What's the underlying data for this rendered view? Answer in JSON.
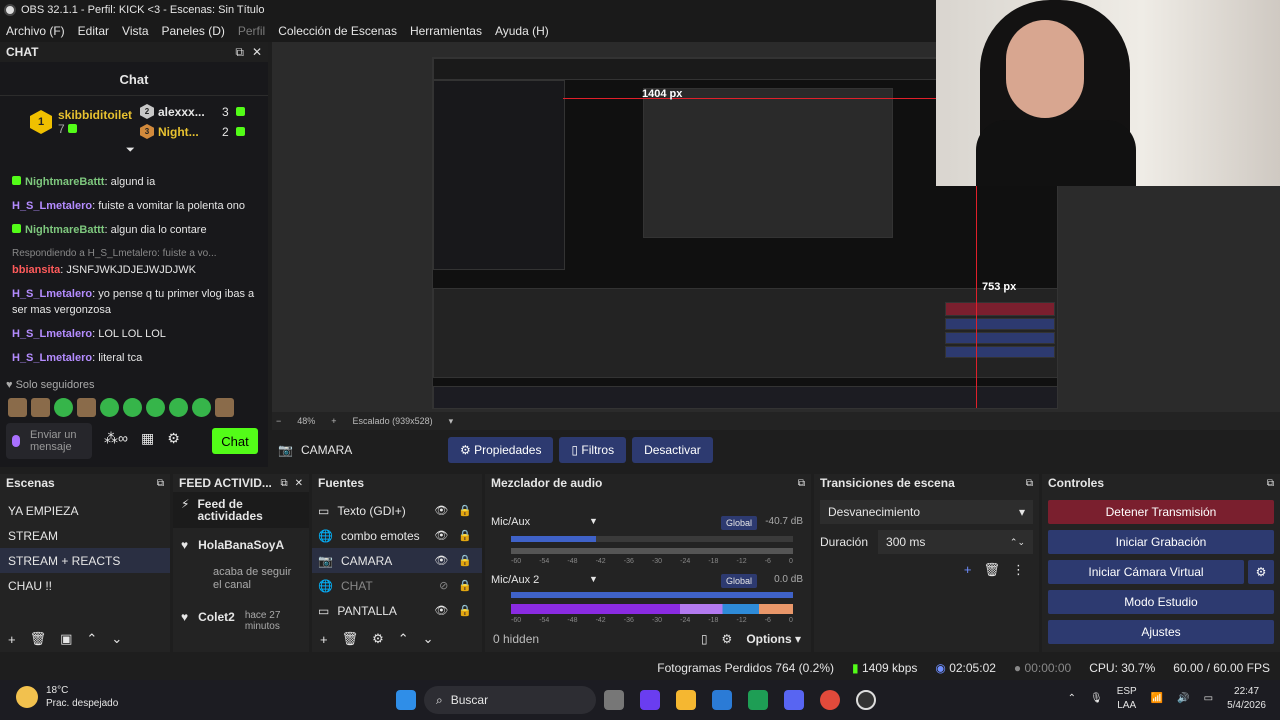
{
  "window": {
    "title": "OBS 32.1.1 - Perfil: KICK <3 - Escenas: Sin Título"
  },
  "menu": [
    "Archivo (F)",
    "Editar",
    "Vista",
    "Paneles (D)",
    "Perfil",
    "Colección de Escenas",
    "Herramientas",
    "Ayuda (H)"
  ],
  "chat": {
    "dock_title": "CHAT",
    "title": "Chat",
    "leader": {
      "rank": "1",
      "name": "skibbiditoilet",
      "count": "7"
    },
    "ranks": [
      {
        "rank": "2",
        "name": "alexxx...",
        "count": "3"
      },
      {
        "rank": "3",
        "name": "Night...",
        "count": "2"
      }
    ],
    "messages": [
      {
        "user": "NightmareBattt",
        "text": "algund ia"
      },
      {
        "user": "H_S_Lmetalero",
        "text": "fuiste a vomitar la polenta ono"
      },
      {
        "user": "NightmareBattt",
        "text": "algun dia lo contare"
      },
      {
        "reply": "Respondiendo a H_S_Lmetalero: fuiste a vo...",
        "user": "bbiansita",
        "text": "JSNFJWKJDJEJWJDJWK"
      },
      {
        "user": "H_S_Lmetalero",
        "text": "yo pense q tu primer vlog ibas a ser mas vergonzosa"
      },
      {
        "user": "H_S_Lmetalero",
        "text": "LOL LOL LOL"
      },
      {
        "user": "H_S_Lmetalero",
        "text": "literal tca"
      }
    ],
    "followers_only": "Solo seguidores",
    "input_placeholder": "Enviar un mensaje",
    "send_label": "Chat"
  },
  "preview": {
    "measure_w": "1404 px",
    "measure_h": "753 px",
    "zoom": "48%",
    "scaling": "Escalado (939x528)"
  },
  "source_bar": {
    "name": "CAMARA",
    "properties": "Propiedades",
    "filters": "Filtros",
    "deactivate": "Desactivar"
  },
  "scenes": {
    "title": "Escenas",
    "items": [
      "YA EMPIEZA",
      "STREAM",
      "STREAM + REACTS",
      "CHAU !!"
    ],
    "selected": 2
  },
  "feed": {
    "title": "FEED ACTIVID...",
    "header": "Feed de actividades",
    "items": [
      {
        "name": "HolaBanaSoyA",
        "action": "acaba de seguir el canal"
      },
      {
        "name": "Colet2",
        "time": "hace 27 minutos"
      }
    ]
  },
  "sources": {
    "title": "Fuentes",
    "items": [
      {
        "name": "Texto (GDI+)",
        "icon": "text-icon"
      },
      {
        "name": "combo emotes",
        "icon": "globe-icon"
      },
      {
        "name": "CAMARA",
        "icon": "camera-icon"
      },
      {
        "name": "CHAT",
        "icon": "globe-icon"
      },
      {
        "name": "PANTALLA",
        "icon": "monitor-icon"
      }
    ]
  },
  "mixer": {
    "title": "Mezclador de audio",
    "channels": [
      {
        "name": "Mic/Aux",
        "scope": "Global",
        "db": "-40.7 dB",
        "volume": 0.3
      },
      {
        "name": "Mic/Aux 2",
        "scope": "Global",
        "db": "0.0 dB",
        "volume": 1.0
      }
    ],
    "scale": [
      "-60",
      "-54",
      "-48",
      "-42",
      "-36",
      "-30",
      "-24",
      "-18",
      "-12",
      "-6",
      "0"
    ],
    "hidden": "0 hidden",
    "options": "Options"
  },
  "transitions": {
    "title": "Transiciones de escena",
    "selected": "Desvanecimiento",
    "duration_label": "Duración",
    "duration": "300 ms"
  },
  "controls": {
    "title": "Controles",
    "buttons": [
      "Detener Transmisión",
      "Iniciar Grabación",
      "Iniciar Cámara Virtual",
      "Modo Estudio",
      "Ajustes"
    ]
  },
  "status": {
    "dropped": "Fotogramas Perdidos 764 (0.2%)",
    "bitrate": "1409 kbps",
    "stream_time": "02:05:02",
    "rec_time": "00:00:00",
    "cpu": "CPU: 30.7%",
    "fps": "60.00 / 60.00 FPS"
  },
  "taskbar": {
    "temp": "18°C",
    "weather": "Prac. despejado",
    "search": "Buscar",
    "lang1": "ESP",
    "lang2": "LAA",
    "time": "22:47",
    "date": "5/4/2026"
  },
  "colors": {
    "accent": "#2d3a70",
    "stream_stop": "#7a1f2e",
    "kick_green": "#53fc18"
  }
}
